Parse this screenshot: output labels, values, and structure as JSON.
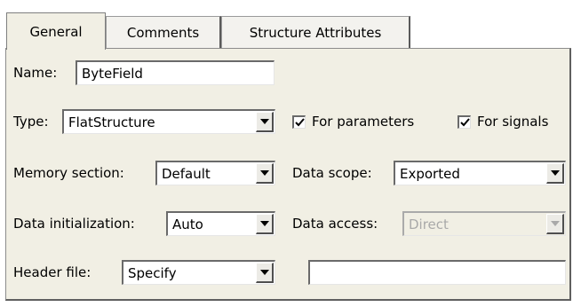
{
  "tabs": [
    {
      "label": "General",
      "active": true
    },
    {
      "label": "Comments",
      "active": false
    },
    {
      "label": "Structure Attributes",
      "active": false
    }
  ],
  "form": {
    "name_label": "Name:",
    "name_value": "ByteField",
    "type_label": "Type:",
    "type_value": "FlatStructure",
    "for_parameters_label": "For parameters",
    "for_parameters_checked": true,
    "for_signals_label": "For signals",
    "for_signals_checked": true,
    "memory_section_label": "Memory section:",
    "memory_section_value": "Default",
    "data_scope_label": "Data scope:",
    "data_scope_value": "Exported",
    "data_initialization_label": "Data initialization:",
    "data_initialization_value": "Auto",
    "data_access_label": "Data access:",
    "data_access_value": "Direct",
    "data_access_disabled": true,
    "header_file_label": "Header file:",
    "header_file_value": "Specify",
    "header_file_name_value": ""
  }
}
